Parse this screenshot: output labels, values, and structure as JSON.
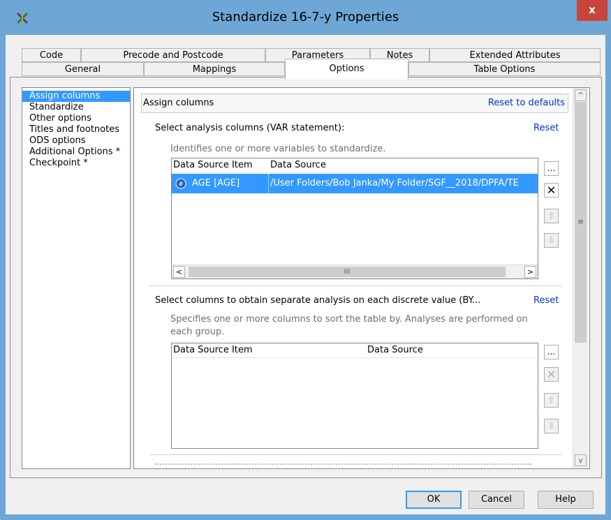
{
  "window": {
    "title": "Standardize 16-7-y Properties",
    "close_label": "x"
  },
  "tabs_top": [
    {
      "label": "Code"
    },
    {
      "label": "Precode and Postcode"
    },
    {
      "label": "Parameters"
    },
    {
      "label": "Notes"
    },
    {
      "label": "Extended Attributes"
    }
  ],
  "tabs_bottom": [
    {
      "label": "General"
    },
    {
      "label": "Mappings"
    },
    {
      "label": "Options",
      "active": true
    },
    {
      "label": "Table Options"
    }
  ],
  "sidebar": {
    "items": [
      {
        "label": "Assign columns",
        "selected": true
      },
      {
        "label": "Standardize"
      },
      {
        "label": "Other options"
      },
      {
        "label": "Titles and footnotes"
      },
      {
        "label": "ODS options"
      },
      {
        "label": "Additional Options *"
      },
      {
        "label": "Checkpoint *"
      }
    ]
  },
  "panel": {
    "section_title": "Assign columns",
    "reset_defaults": "Reset to defaults",
    "var": {
      "heading": "Select analysis columns (VAR statement):",
      "reset": "Reset",
      "description": "Identifies one or more variables to standardize.",
      "col_item": "Data Source Item",
      "col_source": "Data Source",
      "row_item": "AGE [AGE]",
      "row_source": "/User Folders/Bob Janka/My Folder/SGF__2018/DPFA/TE",
      "hscroll_grip": "III"
    },
    "by": {
      "heading": "Select columns to obtain separate analysis on each discrete value (BY...",
      "reset": "Reset",
      "description_line1": "Specifies one or more columns to sort the table by. Analyses are performed on",
      "description_line2": "each group.",
      "col_item": "Data Source Item",
      "col_source": "Data Source"
    },
    "side_buttons": {
      "browse": "...",
      "remove": "✕",
      "up": "⇧",
      "down": "⇩"
    },
    "scroll": {
      "up": "^",
      "grip": "≡",
      "down": "v"
    }
  },
  "footer": {
    "ok": "OK",
    "cancel": "Cancel",
    "help": "Help"
  },
  "colors": {
    "title_bar": "#6ea7d6",
    "close": "#c7453b",
    "selection": "#3399ff",
    "link": "#0033cc"
  }
}
